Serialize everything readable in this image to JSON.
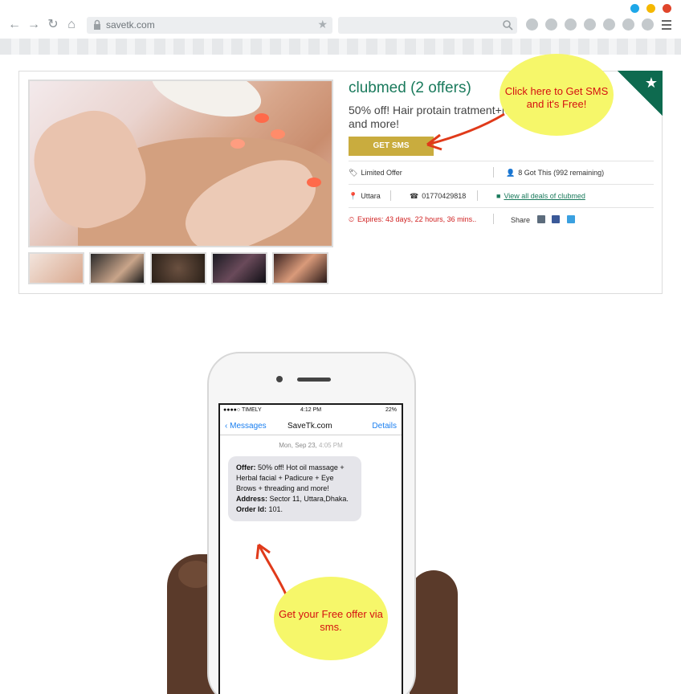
{
  "browser": {
    "url": "savetk.com",
    "dots": [
      "#1ea7e8",
      "#f5b800",
      "#e0452b"
    ]
  },
  "deal": {
    "title": "clubmed (2 offers)",
    "description": "50% off! Hair protain tratment+M Brows+threading and more!",
    "get_sms_label": "GET SMS",
    "limited_offer": "Limited Offer",
    "got_this": "8 Got This (992 remaining)",
    "location": "Uttara",
    "phone": "01770429818",
    "view_all": "View all deals of clubmed",
    "expires": "Expires: 43 days, 22 hours, 36 mins..",
    "share_label": "Share",
    "accent_color": "#1a7a5c",
    "button_color": "#c9ac3e"
  },
  "callouts": {
    "sms_hint": "Click here to Get SMS and it's Free!",
    "free_offer": "Get your Free offer via sms."
  },
  "phone": {
    "status_carrier": "●●●●○ TIMELY",
    "status_time": "4:12 PM",
    "status_battery": "22%",
    "back_label": "Messages",
    "contact": "SaveTk.com",
    "details_label": "Details",
    "date": "Mon, Sep 23,",
    "time": "4:05 PM",
    "offer_label": "Offer:",
    "offer_text": "50% off! Hot oil massage + Herbal facial + Padicure + Eye Brows + threading and more!",
    "address_label": "Address:",
    "address_text": "Sector 11, Uttara,Dhaka.",
    "order_label": "Order Id:",
    "order_text": "101."
  }
}
